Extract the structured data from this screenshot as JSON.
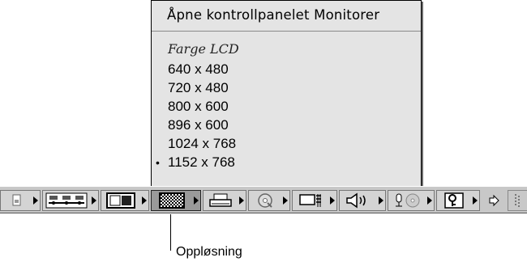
{
  "menu": {
    "title": "Åpne kontrollpanelet Monitorer",
    "section_header": "Farge LCD",
    "items": [
      {
        "label": "640 x 480",
        "checked": false
      },
      {
        "label": "720 x 480",
        "checked": false
      },
      {
        "label": "800 x 600",
        "checked": false
      },
      {
        "label": "896 x 600",
        "checked": false
      },
      {
        "label": "1024 x 768",
        "checked": false
      },
      {
        "label": "1152 x 768",
        "checked": true
      }
    ],
    "check_mark": "•"
  },
  "control_strip": {
    "modules": [
      {
        "icon": "file-sharing-icon"
      },
      {
        "icon": "appletalk-icon"
      },
      {
        "icon": "monitor-bitdepth-icon"
      },
      {
        "icon": "resolution-icon",
        "active": true
      },
      {
        "icon": "printer-icon"
      },
      {
        "icon": "cd-icon"
      },
      {
        "icon": "energy-saver-icon"
      },
      {
        "icon": "speaker-volume-icon"
      },
      {
        "icon": "sound-input-icon"
      },
      {
        "icon": "keychain-icon"
      },
      {
        "icon": "scroll-arrow-icon"
      }
    ]
  },
  "callout": {
    "label": "Oppløsning"
  }
}
